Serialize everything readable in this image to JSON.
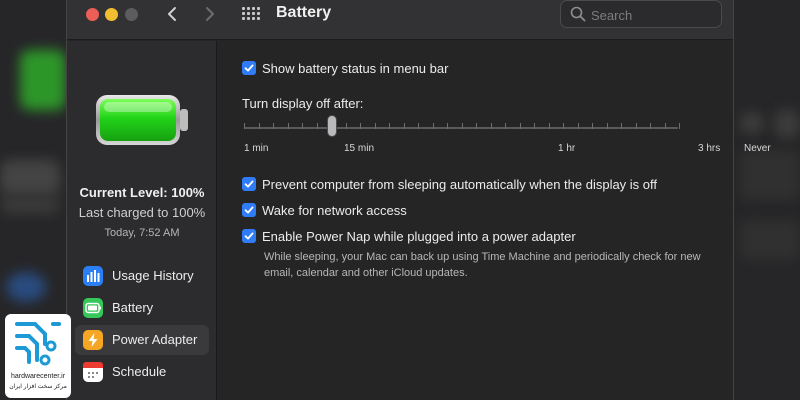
{
  "window": {
    "title": "Battery",
    "search": {
      "placeholder": "Search",
      "value": ""
    }
  },
  "sidebar": {
    "current_level": "Current Level: 100%",
    "last_charged": "Last charged to 100%",
    "charged_time": "Today, 7:52 AM",
    "items": [
      {
        "label": "Usage History",
        "icon": "chart-icon",
        "color": "#2a7ff5"
      },
      {
        "label": "Battery",
        "icon": "battery-icon",
        "color": "#35c759"
      },
      {
        "label": "Power Adapter",
        "icon": "bolt-icon",
        "color": "#f5a623",
        "selected": true
      },
      {
        "label": "Schedule",
        "icon": "calendar-icon",
        "color": "#ffffff"
      }
    ]
  },
  "settings": {
    "show_status": {
      "label": "Show battery status in menu bar",
      "checked": true
    },
    "display_off": {
      "label": "Turn display off after:",
      "ticks": [
        "1 min",
        "15 min",
        "1 hr",
        "3 hrs",
        "Never"
      ],
      "value": "15 min"
    },
    "prevent_sleep": {
      "label": "Prevent computer from sleeping automatically when the display is off",
      "checked": true
    },
    "wake_network": {
      "label": "Wake for network access",
      "checked": true
    },
    "power_nap": {
      "label": "Enable Power Nap while plugged into a power adapter",
      "checked": true,
      "description": "While sleeping, your Mac can back up using Time Machine and periodically check for new email, calendar and other iCloud updates."
    }
  },
  "watermark": {
    "text": "hardwarecenter.ir",
    "subtitle": "مرکز سخت افزار ایران"
  },
  "colors": {
    "accent": "#2f7cf6",
    "battery_green": "#35c759"
  }
}
